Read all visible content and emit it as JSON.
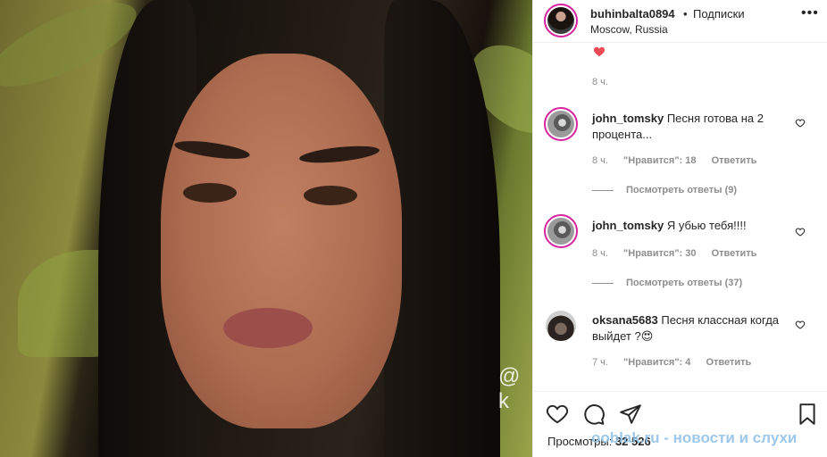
{
  "post": {
    "watermark": "@ k"
  },
  "header": {
    "username": "buhinbalta0894",
    "dot": "•",
    "follow_label": "Подписки",
    "location": "Moscow, Russia",
    "more_icon": "more-icon"
  },
  "caption": {
    "time": "8 ч."
  },
  "comments": [
    {
      "username": "john_tomsky",
      "text": "Песня готова на 2 процента...",
      "time": "8 ч.",
      "likes": "\"Нравится\": 18",
      "reply": "Ответить",
      "view_replies": "Посмотреть ответы (9)"
    },
    {
      "username": "john_tomsky",
      "text": "Я убью тебя!!!!",
      "time": "8 ч.",
      "likes": "\"Нравится\": 30",
      "reply": "Ответить",
      "view_replies": "Посмотреть ответы (37)"
    },
    {
      "username": "oksana5683",
      "text": "Песня классная когда выйдет ?😍",
      "time": "7 ч.",
      "likes": "\"Нравится\": 4",
      "reply": "Ответить"
    }
  ],
  "footer": {
    "views_label": "Просмотры:",
    "views_count": "32 526",
    "site_watermark": "ooblak.ru - новости и слухи"
  },
  "colors": {
    "heart_red": "#ed4956",
    "muted": "#8e8e8e",
    "text": "#262626"
  }
}
